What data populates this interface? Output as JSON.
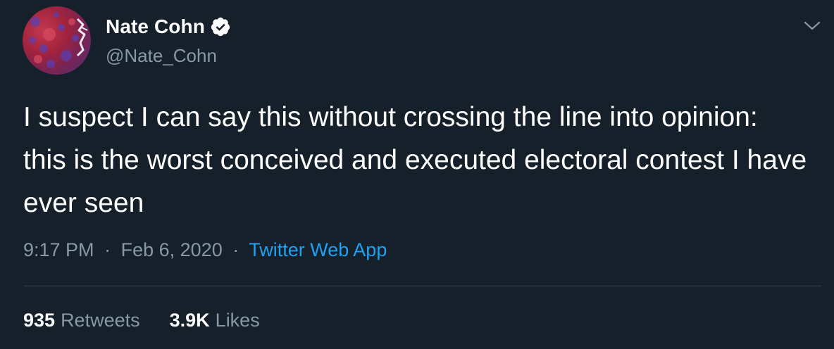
{
  "tweet": {
    "author": {
      "display_name": "Nate Cohn",
      "handle": "@Nate_Cohn",
      "verified": true,
      "avatar_icon": "avatar-map-icon"
    },
    "text": "I suspect I can say this without crossing the line into opinion:  this is the worst conceived and executed electoral contest I have ever seen",
    "time": "9:17 PM",
    "date": "Feb 6, 2020",
    "separator": "·",
    "source": "Twitter Web App",
    "stats": {
      "retweets_count": "935",
      "retweets_label": "Retweets",
      "likes_count": "3.9K",
      "likes_label": "Likes"
    },
    "menu_icon": "chevron-down-icon"
  },
  "colors": {
    "background": "#15202b",
    "text_primary": "#ffffff",
    "text_secondary": "#8899a6",
    "link": "#1da1f2",
    "divider": "#38444d"
  }
}
